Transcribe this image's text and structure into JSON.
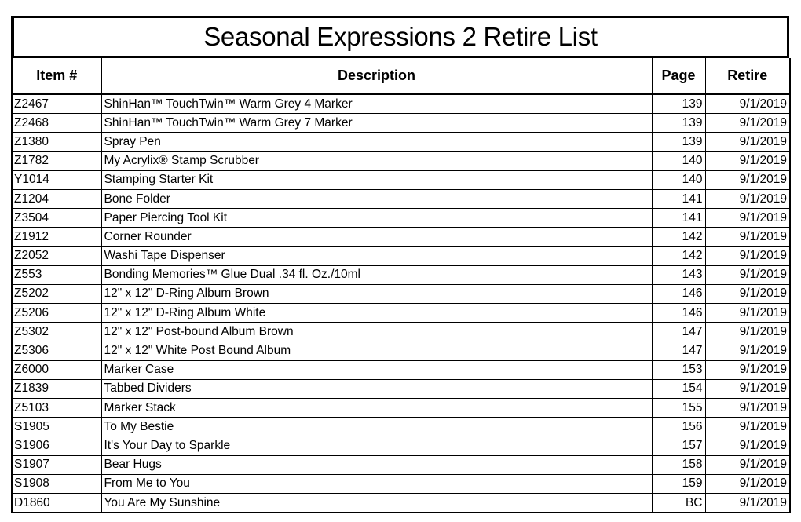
{
  "document": {
    "title": "Seasonal Expressions 2 Retire List"
  },
  "table": {
    "headers": {
      "item": "Item #",
      "description": "Description",
      "page": "Page",
      "retire": "Retire"
    },
    "rows": [
      {
        "item": "Z2467",
        "description": "ShinHan™ TouchTwin™ Warm Grey 4 Marker",
        "page": "139",
        "retire": "9/1/2019"
      },
      {
        "item": "Z2468",
        "description": "ShinHan™ TouchTwin™ Warm Grey 7 Marker",
        "page": "139",
        "retire": "9/1/2019"
      },
      {
        "item": "Z1380",
        "description": "Spray Pen",
        "page": "139",
        "retire": "9/1/2019"
      },
      {
        "item": "Z1782",
        "description": "My Acrylix® Stamp Scrubber",
        "page": "140",
        "retire": "9/1/2019"
      },
      {
        "item": "Y1014",
        "description": "Stamping Starter Kit",
        "page": "140",
        "retire": "9/1/2019"
      },
      {
        "item": "Z1204",
        "description": "Bone Folder",
        "page": "141",
        "retire": "9/1/2019"
      },
      {
        "item": "Z3504",
        "description": "Paper Piercing Tool Kit",
        "page": "141",
        "retire": "9/1/2019"
      },
      {
        "item": "Z1912",
        "description": "Corner Rounder",
        "page": "142",
        "retire": "9/1/2019"
      },
      {
        "item": "Z2052",
        "description": "Washi Tape Dispenser",
        "page": "142",
        "retire": "9/1/2019"
      },
      {
        "item": "Z553",
        "description": "Bonding Memories™ Glue Dual .34 fl. Oz./10ml",
        "page": "143",
        "retire": "9/1/2019"
      },
      {
        "item": "Z5202",
        "description": "12\" x 12\"  D-Ring Album Brown",
        "page": "146",
        "retire": "9/1/2019"
      },
      {
        "item": "Z5206",
        "description": "12\" x 12\"  D-Ring Album White",
        "page": "146",
        "retire": "9/1/2019"
      },
      {
        "item": "Z5302",
        "description": "12\" x 12\"  Post-bound Album Brown",
        "page": "147",
        "retire": "9/1/2019"
      },
      {
        "item": "Z5306",
        "description": "12\" x 12\" White Post Bound Album",
        "page": "147",
        "retire": "9/1/2019"
      },
      {
        "item": "Z6000",
        "description": "Marker Case",
        "page": "153",
        "retire": "9/1/2019"
      },
      {
        "item": "Z1839",
        "description": "Tabbed Dividers",
        "page": "154",
        "retire": "9/1/2019"
      },
      {
        "item": "Z5103",
        "description": "Marker Stack",
        "page": "155",
        "retire": "9/1/2019"
      },
      {
        "item": "S1905",
        "description": "To My Bestie",
        "page": "156",
        "retire": "9/1/2019"
      },
      {
        "item": "S1906",
        "description": "It's Your Day to Sparkle",
        "page": "157",
        "retire": "9/1/2019"
      },
      {
        "item": "S1907",
        "description": "Bear Hugs",
        "page": "158",
        "retire": "9/1/2019"
      },
      {
        "item": "S1908",
        "description": "From Me to You",
        "page": "159",
        "retire": "9/1/2019"
      },
      {
        "item": "D1860",
        "description": "You Are My Sunshine",
        "page": "BC",
        "retire": "9/1/2019"
      }
    ]
  }
}
